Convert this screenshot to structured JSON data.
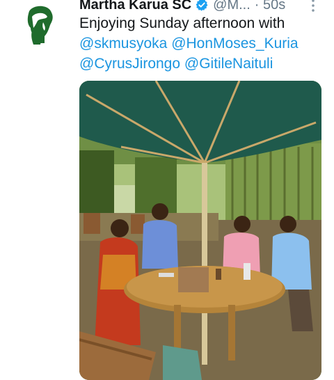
{
  "tweet": {
    "author_name": "Martha Karua SC",
    "handle": "@M...",
    "time": "· 50s",
    "text_line1": "Enjoying Sunday afternoon with",
    "mentions": [
      "@skmusyoka",
      "@HonMoses_Kuria",
      "@CyrusJirongo",
      "@GitileNaituli"
    ]
  },
  "icons": {
    "avatar": "portrait-logo-icon",
    "verified": "verified-badge-icon",
    "more": "more-vertical-icon"
  },
  "colors": {
    "mention": "#1b95e0",
    "verified": "#1da1f2",
    "avatar_green": "#1f6b2c",
    "umbrella": "#1f5a4c"
  }
}
